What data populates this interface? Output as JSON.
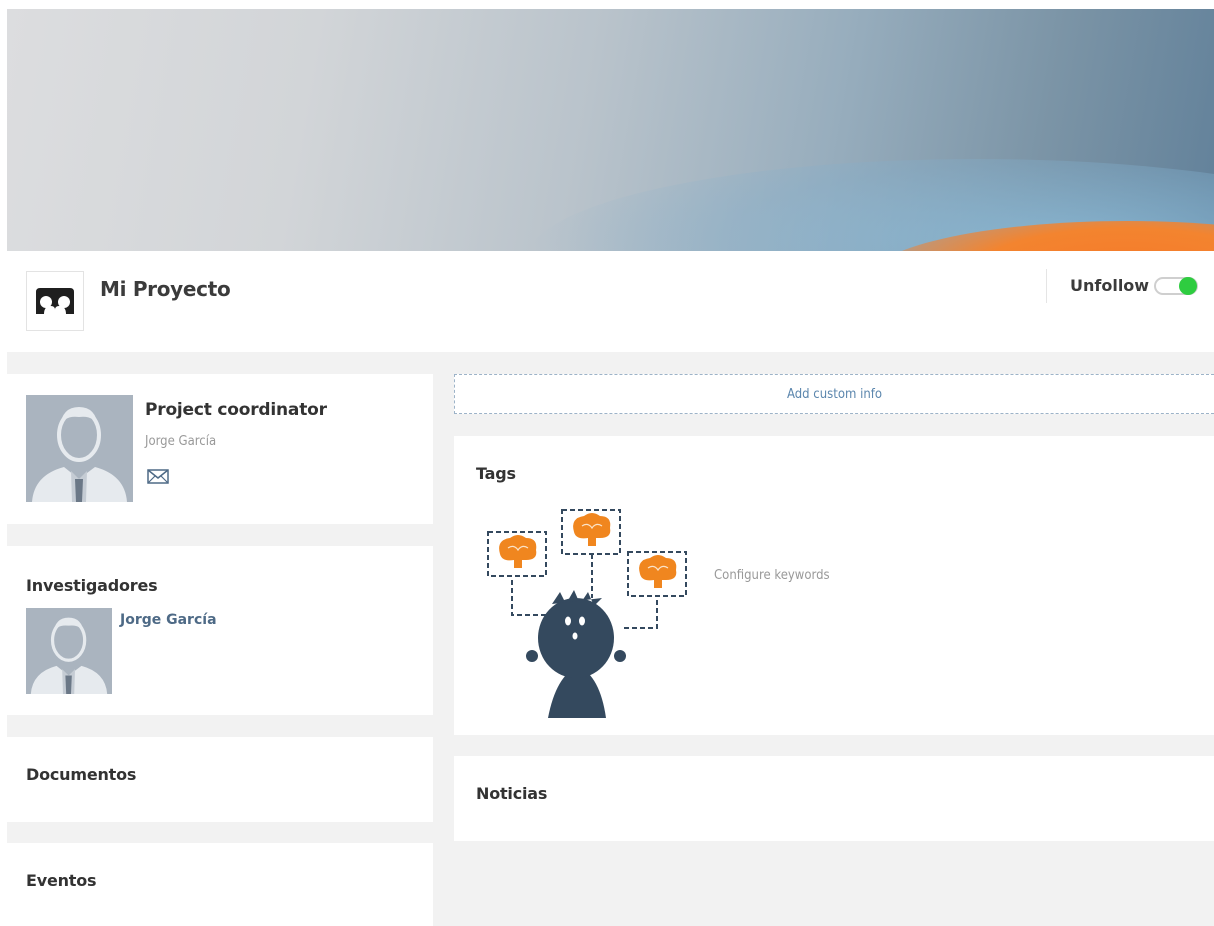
{
  "project": {
    "title": "Mi Proyecto",
    "follow_label": "Unfollow",
    "following": true
  },
  "coordinator": {
    "heading": "Project coordinator",
    "name": "Jorge García"
  },
  "researchers": {
    "heading": "Investigadores",
    "items": [
      {
        "name": "Jorge García"
      }
    ]
  },
  "documents": {
    "heading": "Documentos"
  },
  "events": {
    "heading": "Eventos"
  },
  "custom_info": {
    "label": "Add custom info"
  },
  "tags": {
    "heading": "Tags",
    "configure_label": "Configure keywords"
  },
  "news": {
    "heading": "Noticias"
  },
  "colors": {
    "accent_green": "#2ecc40",
    "link_blue": "#5b86ad",
    "brain_orange": "#f0861f",
    "illustration_dark": "#34495e"
  }
}
